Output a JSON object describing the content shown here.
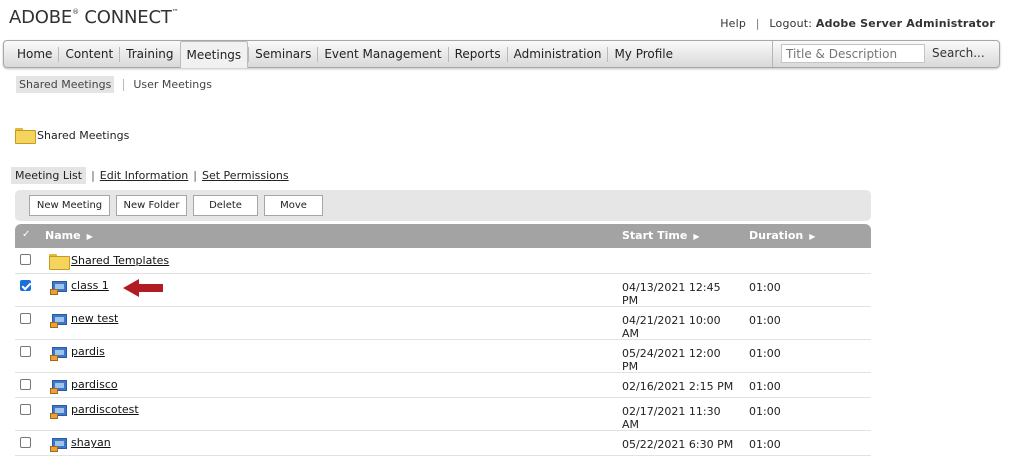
{
  "app": {
    "logo": "ADOBE",
    "logo_mark": "®",
    "logo_rest": "CONNECT",
    "logo_tm": "™"
  },
  "top_links": {
    "help": "Help",
    "logout_label": "Logout:",
    "user": "Adobe Server Administrator"
  },
  "nav": {
    "tabs": [
      {
        "label": "Home"
      },
      {
        "label": "Content"
      },
      {
        "label": "Training"
      },
      {
        "label": "Meetings"
      },
      {
        "label": "Seminars"
      },
      {
        "label": "Event Management"
      },
      {
        "label": "Reports"
      },
      {
        "label": "Administration"
      },
      {
        "label": "My Profile"
      }
    ],
    "active_tab": "Meetings",
    "search_placeholder": "Title & Description",
    "search_button": "Search..."
  },
  "subnav": {
    "items": [
      "Shared Meetings",
      "User Meetings"
    ],
    "active": "Shared Meetings"
  },
  "folder": {
    "title": "Shared Meetings"
  },
  "actions": {
    "meeting_list": "Meeting List",
    "edit_information": "Edit Information",
    "set_permissions": "Set Permissions"
  },
  "toolbar": {
    "new_meeting": "New Meeting",
    "new_folder": "New Folder",
    "delete": "Delete",
    "move": "Move"
  },
  "grid": {
    "columns": {
      "name": "Name",
      "start_time": "Start Time",
      "duration": "Duration"
    },
    "rows": [
      {
        "name": "Shared Templates",
        "type": "folder",
        "start_line1": "",
        "start_line2": "",
        "duration": "",
        "checked": false
      },
      {
        "name": "class 1",
        "type": "meeting",
        "start_line1": "04/13/2021 12:45",
        "start_line2": "PM",
        "duration": "01:00",
        "checked": true
      },
      {
        "name": "new test",
        "type": "meeting",
        "start_line1": "04/21/2021 10:00",
        "start_line2": "AM",
        "duration": "01:00",
        "checked": false
      },
      {
        "name": "pardis",
        "type": "meeting",
        "start_line1": "05/24/2021 12:00",
        "start_line2": "PM",
        "duration": "01:00",
        "checked": false
      },
      {
        "name": "pardisco",
        "type": "meeting",
        "start_line1": "02/16/2021 2:15 PM",
        "start_line2": "",
        "duration": "01:00",
        "checked": false
      },
      {
        "name": "pardiscotest",
        "type": "meeting",
        "start_line1": "02/17/2021 11:30",
        "start_line2": "AM",
        "duration": "01:00",
        "checked": false
      },
      {
        "name": "shayan",
        "type": "meeting",
        "start_line1": "05/22/2021 6:30 PM",
        "start_line2": "",
        "duration": "01:00",
        "checked": false
      }
    ]
  },
  "colors": {
    "arrow": "#b11c24",
    "header": "#a3a3a3",
    "checkbox_on": "#1a6fdc"
  }
}
